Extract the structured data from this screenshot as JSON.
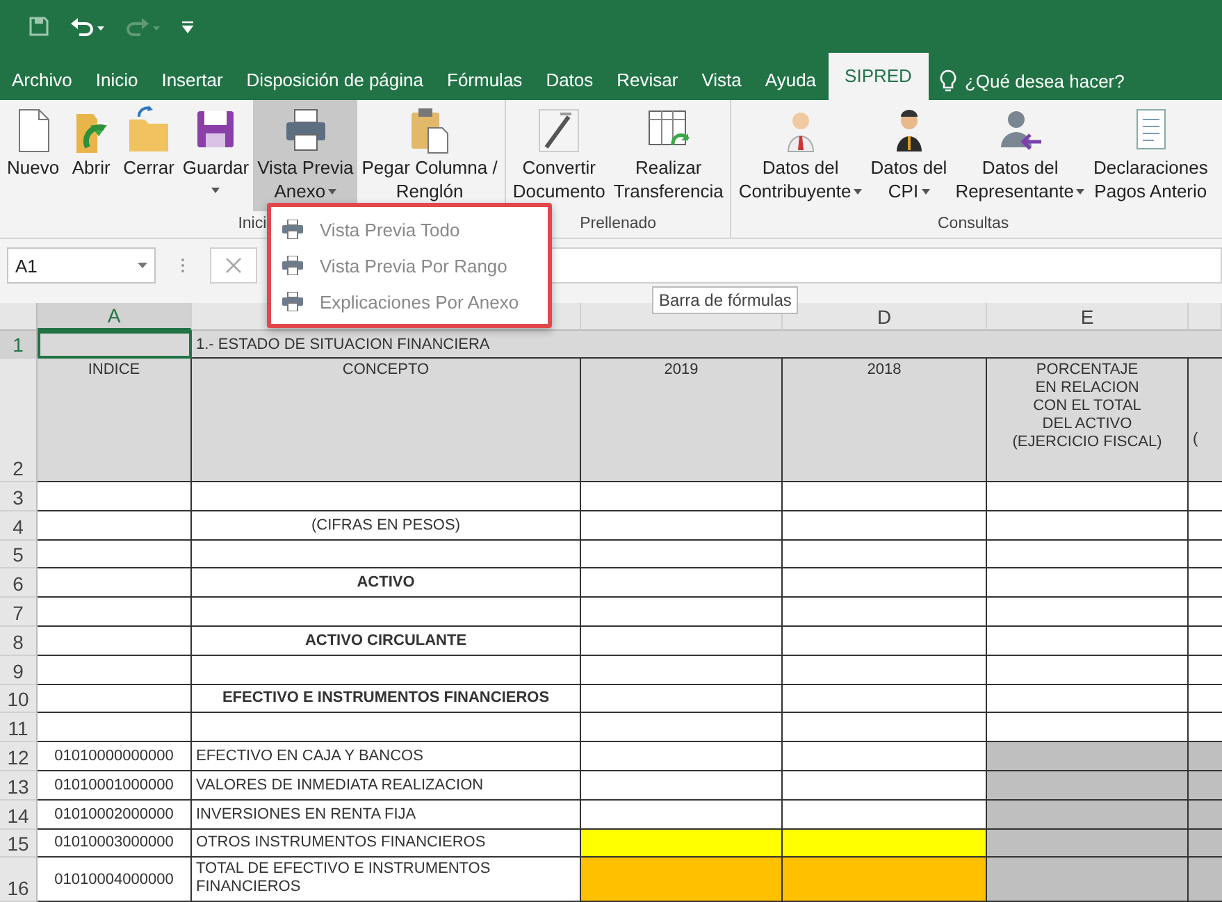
{
  "quick_access": {
    "undo_available": true,
    "redo_available": false
  },
  "tabs": [
    {
      "label": "Archivo",
      "selected": false
    },
    {
      "label": "Inicio",
      "selected": false
    },
    {
      "label": "Insertar",
      "selected": false
    },
    {
      "label": "Disposición de página",
      "selected": false
    },
    {
      "label": "Fórmulas",
      "selected": false
    },
    {
      "label": "Datos",
      "selected": false
    },
    {
      "label": "Revisar",
      "selected": false
    },
    {
      "label": "Vista",
      "selected": false
    },
    {
      "label": "Ayuda",
      "selected": false
    },
    {
      "label": "SIPRED",
      "selected": true
    }
  ],
  "tell_me": {
    "placeholder": "¿Qué desea hacer?"
  },
  "ribbon_groups": [
    {
      "label": "Inici",
      "buttons": [
        {
          "kind": "new",
          "lines": [
            "Nuevo"
          ],
          "dropdown": false,
          "selected": false
        },
        {
          "kind": "open",
          "lines": [
            "Abrir"
          ],
          "dropdown": false,
          "selected": false
        },
        {
          "kind": "folder",
          "lines": [
            "Cerrar"
          ],
          "dropdown": false,
          "selected": false
        },
        {
          "kind": "save",
          "lines": [
            "Guardar"
          ],
          "dropdown": true,
          "selected": false
        },
        {
          "kind": "print",
          "lines": [
            "Vista Previa",
            "Anexo"
          ],
          "dropdown": true,
          "selected": true
        },
        {
          "kind": "paste",
          "lines": [
            "Pegar Columna /",
            "Renglón"
          ],
          "dropdown": false,
          "selected": false
        }
      ]
    },
    {
      "label": "Prellenado",
      "buttons": [
        {
          "kind": "pen",
          "lines": [
            "Convertir",
            "Documento"
          ],
          "dropdown": false,
          "selected": false
        },
        {
          "kind": "table",
          "lines": [
            "Realizar",
            "Transferencia"
          ],
          "dropdown": false,
          "selected": false
        }
      ]
    },
    {
      "label": "Consultas",
      "buttons": [
        {
          "kind": "person",
          "lines": [
            "Datos del",
            "Contribuyente"
          ],
          "dropdown": true,
          "selected": false
        },
        {
          "kind": "person-dark",
          "lines": [
            "Datos del",
            "CPI"
          ],
          "dropdown": true,
          "selected": false
        },
        {
          "kind": "person-arrow",
          "lines": [
            "Datos del",
            "Representante"
          ],
          "dropdown": true,
          "selected": false
        },
        {
          "kind": "document",
          "lines": [
            "Declaraciones",
            "Pagos Anterio"
          ],
          "dropdown": false,
          "selected": false
        }
      ]
    }
  ],
  "name_box": {
    "value": "A1"
  },
  "menu": {
    "items": [
      {
        "label": "Vista Previa Todo"
      },
      {
        "label": "Vista Previa Por Rango"
      },
      {
        "label": "Explicaciones Por Anexo"
      }
    ]
  },
  "tooltip": {
    "text": "Barra de fórmulas"
  },
  "column_headers": [
    {
      "label": "A",
      "selected": true
    },
    {
      "selected": false
    },
    {
      "selected": false
    },
    {
      "label": "D",
      "selected": false
    },
    {
      "label": "E",
      "selected": false
    },
    {
      "selected": false
    }
  ],
  "rows": [
    {
      "number": "1",
      "kind": "title",
      "selected": true,
      "concept": "1.- ESTADO DE SITUACION FINANCIERA"
    },
    {
      "number": "2",
      "kind": "header",
      "selected": false,
      "index": "INDICE",
      "concept": "CONCEPTO",
      "c": "2019",
      "d": "2018",
      "e_lines": [
        "PORCENTAJE",
        "EN RELACION",
        "CON EL TOTAL",
        "DEL ACTIVO",
        "(EJERCICIO FISCAL)"
      ],
      "f": "("
    },
    {
      "number": "3",
      "kind": "blank",
      "selected": false
    },
    {
      "number": "4",
      "kind": "subtitle",
      "selected": false,
      "concept": "(CIFRAS EN PESOS)"
    },
    {
      "number": "5",
      "kind": "blank",
      "selected": false
    },
    {
      "number": "6",
      "kind": "heading",
      "selected": false,
      "concept": "ACTIVO"
    },
    {
      "number": "7",
      "kind": "blank",
      "selected": false
    },
    {
      "number": "8",
      "kind": "heading",
      "selected": false,
      "concept": "ACTIVO CIRCULANTE"
    },
    {
      "number": "9",
      "kind": "blank",
      "selected": false
    },
    {
      "number": "10",
      "kind": "heading",
      "selected": false,
      "concept": "EFECTIVO E INSTRUMENTOS FINANCIEROS"
    },
    {
      "number": "11",
      "kind": "blank",
      "selected": false
    },
    {
      "number": "12",
      "kind": "item",
      "selected": false,
      "index": "01010000000000",
      "concept": "EFECTIVO EN CAJA Y BANCOS"
    },
    {
      "number": "13",
      "kind": "item",
      "selected": false,
      "index": "01010001000000",
      "concept": "VALORES DE INMEDIATA REALIZACION"
    },
    {
      "number": "14",
      "kind": "item",
      "selected": false,
      "index": "01010002000000",
      "concept": "INVERSIONES EN RENTA FIJA"
    },
    {
      "number": "15",
      "kind": "item-input",
      "selected": false,
      "index": "01010003000000",
      "concept": "OTROS INSTRUMENTOS FINANCIEROS"
    },
    {
      "number": "16",
      "kind": "item-total",
      "selected": false,
      "index": "01010004000000",
      "concept": "TOTAL DE EFECTIVO E INSTRUMENTOS FINANCIEROS"
    }
  ]
}
